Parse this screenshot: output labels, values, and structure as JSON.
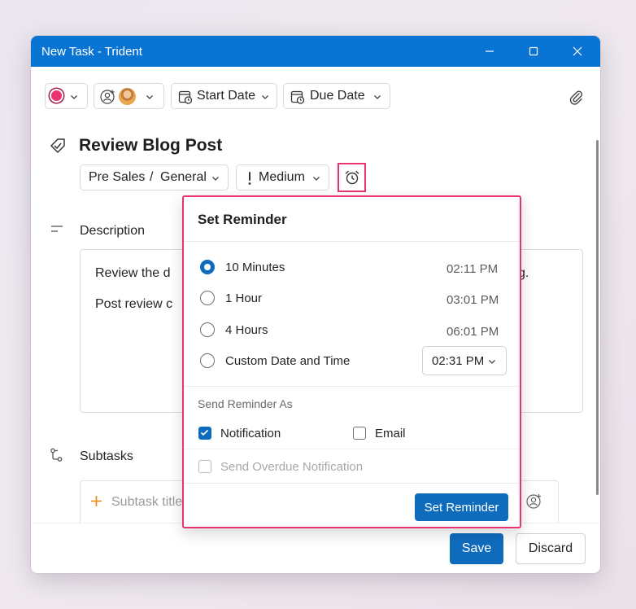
{
  "window": {
    "title": "New Task - Trident"
  },
  "toolbar": {
    "start_date": "Start Date",
    "due_date": "Due Date"
  },
  "task": {
    "title": "Review Blog Post",
    "project": "Pre Sales",
    "project_sep": "/",
    "category": "General",
    "priority": "Medium"
  },
  "description": {
    "label": "Description",
    "line1": "Review the d",
    "line1_end": "g.",
    "line2": "Post review c"
  },
  "subtasks": {
    "label": "Subtasks",
    "placeholder": "Subtask title"
  },
  "reminder": {
    "header": "Set Reminder",
    "options": [
      {
        "label": "10 Minutes",
        "time": "02:11 PM",
        "selected": true
      },
      {
        "label": "1 Hour",
        "time": "03:01 PM",
        "selected": false
      },
      {
        "label": "4 Hours",
        "time": "06:01 PM",
        "selected": false
      },
      {
        "label": "Custom Date and Time",
        "time": "02:31 PM",
        "selected": false
      }
    ],
    "send_as_label": "Send Reminder As",
    "notification_label": "Notification",
    "email_label": "Email",
    "overdue_label": "Send Overdue Notification",
    "button_label": "Set Reminder"
  },
  "footer": {
    "save": "Save",
    "discard": "Discard"
  },
  "colors": {
    "accent": "#0f6cbd",
    "titlebar": "#0a74d4",
    "highlight": "#e8336f",
    "status_dot": "#e8336f"
  }
}
